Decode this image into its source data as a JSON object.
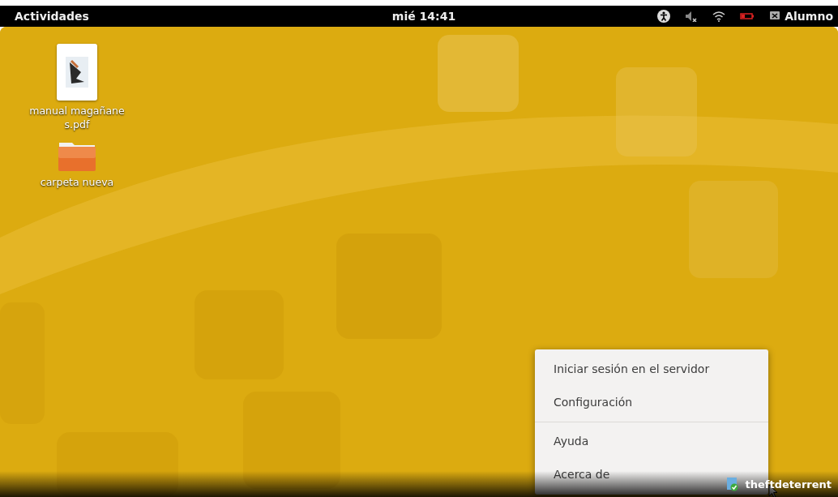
{
  "top_bar": {
    "activities": "Actividades",
    "clock": "mié 14:41",
    "user": "Alumno"
  },
  "desktop_icons": [
    {
      "kind": "pdf",
      "label": "manual magañanes.pdf"
    },
    {
      "kind": "folder",
      "label": "carpeta nueva"
    }
  ],
  "context_menu": [
    {
      "kind": "item",
      "label": "Iniciar sesión en el servidor"
    },
    {
      "kind": "item",
      "label": "Configuración"
    },
    {
      "kind": "separator"
    },
    {
      "kind": "item",
      "label": "Ayuda"
    },
    {
      "kind": "item",
      "label": "Acerca de"
    }
  ],
  "tray": {
    "label": "theftdeterrent"
  }
}
